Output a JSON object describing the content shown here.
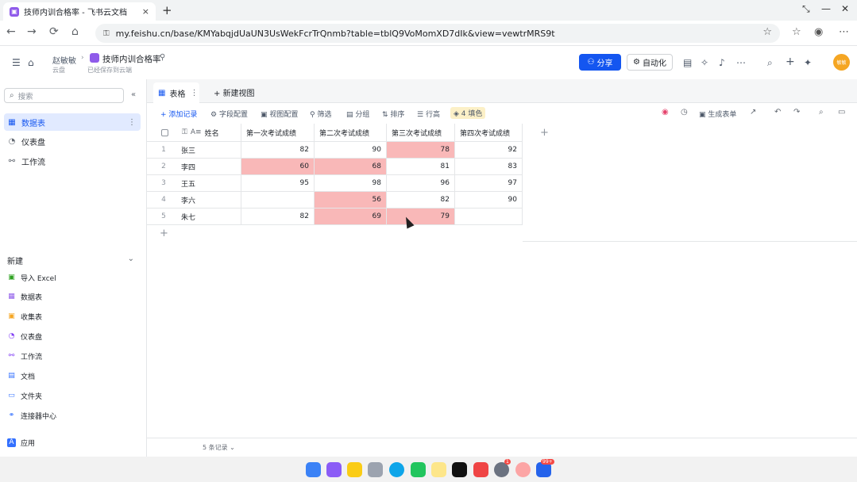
{
  "browser": {
    "tab_title": "技师内训合格率 - 飞书云文档",
    "tab_close": "×",
    "new_tab": "+",
    "url": "my.feishu.cn/base/KMYabqjdUaUN3UsWekFcrTrQnmb?table=tblQ9VoMomXD7dIk&view=vewtrMRS9t",
    "icons": [
      "back-icon",
      "forward-icon",
      "reload-icon",
      "home-icon",
      "lock-icon",
      "star-icon"
    ]
  },
  "header": {
    "user": "赵敏敏",
    "doc_title": "技师内训合格率",
    "location": "云盘",
    "save_status": "已经保存到云端",
    "share_label": "分享",
    "automation_label": "自动化",
    "avatar_text": "敏敏"
  },
  "sidebar": {
    "search_placeholder": "搜索",
    "items": [
      {
        "label": "数据表",
        "icon": "table-icon",
        "active": true
      },
      {
        "label": "仪表盘",
        "icon": "dashboard-icon",
        "active": false
      },
      {
        "label": "工作流",
        "icon": "workflow-icon",
        "active": false
      }
    ],
    "new_label": "新建",
    "new_items": [
      {
        "label": "导入 Excel",
        "icon": "excel-icon",
        "color": "#2ea121"
      },
      {
        "label": "数据表",
        "icon": "table-icon",
        "color": "#8f5bea"
      },
      {
        "label": "收集表",
        "icon": "form-icon",
        "color": "#f5a623"
      },
      {
        "label": "仪表盘",
        "icon": "dashboard-icon",
        "color": "#7f3bf5"
      },
      {
        "label": "工作流",
        "icon": "workflow-icon",
        "color": "#7f3bf5"
      },
      {
        "label": "文档",
        "icon": "doc-icon",
        "color": "#3370ff"
      },
      {
        "label": "文件夹",
        "icon": "folder-icon",
        "color": "#3370ff"
      },
      {
        "label": "连接器中心",
        "icon": "connector-icon",
        "color": "#3370ff"
      }
    ],
    "apps_label": "应用"
  },
  "view": {
    "tab_label": "表格",
    "new_view_label": "新建视图"
  },
  "toolbar": {
    "add_record": "添加记录",
    "field_config": "字段配置",
    "view_config": "视图配置",
    "filter": "筛选",
    "group": "分组",
    "sort": "排序",
    "row_height": "行高",
    "color": "4 填色",
    "generate_form": "生成表单"
  },
  "table": {
    "columns": [
      "姓名",
      "第一次考试成绩",
      "第二次考试成绩",
      "第三次考试成绩",
      "第四次考试成绩"
    ],
    "rows": [
      {
        "index": "1",
        "name": "张三",
        "scores": [
          "82",
          "90",
          "78",
          "92"
        ],
        "red": [
          false,
          false,
          true,
          false
        ]
      },
      {
        "index": "2",
        "name": "李四",
        "scores": [
          "60",
          "68",
          "81",
          "83"
        ],
        "red": [
          true,
          true,
          false,
          false
        ]
      },
      {
        "index": "3",
        "name": "王五",
        "scores": [
          "95",
          "98",
          "96",
          "97"
        ],
        "red": [
          false,
          false,
          false,
          false
        ]
      },
      {
        "index": "4",
        "name": "李六",
        "scores": [
          "",
          "56",
          "82",
          "90"
        ],
        "red": [
          false,
          true,
          false,
          false
        ]
      },
      {
        "index": "5",
        "name": "朱七",
        "scores": [
          "82",
          "69",
          "79",
          ""
        ],
        "red": [
          false,
          true,
          true,
          false
        ]
      }
    ],
    "record_count": "5 条记录 ⌄",
    "highlight_color": "#f9b8b8"
  },
  "dock": {
    "badge_red": "1",
    "badge_mail": "99+"
  }
}
